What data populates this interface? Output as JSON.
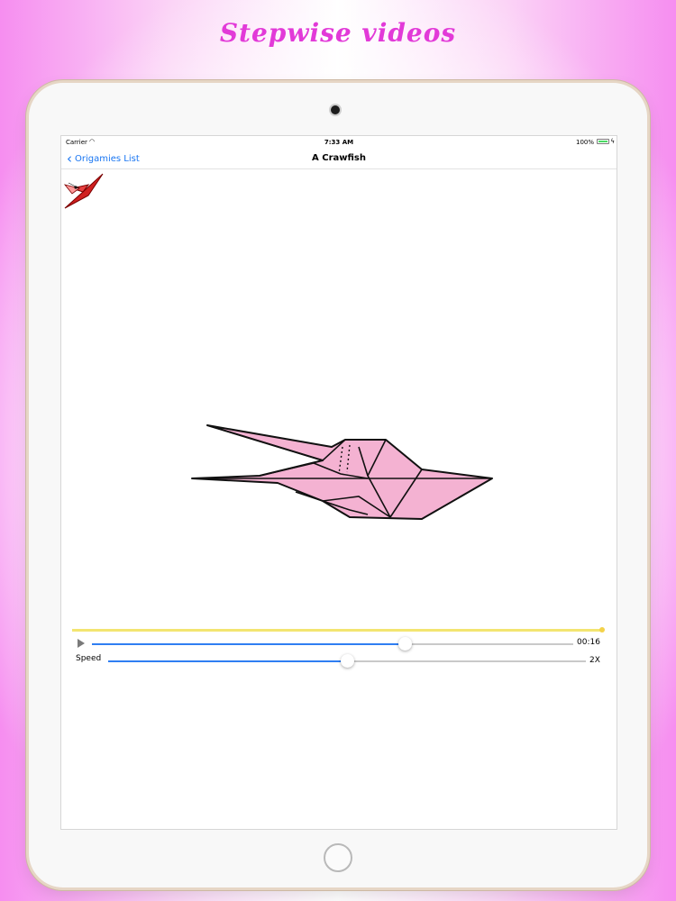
{
  "headline": "Stepwise videos",
  "status_bar": {
    "carrier": "Carrier",
    "time": "7:33 AM",
    "battery": "100%"
  },
  "nav": {
    "back_label": "Origamies List",
    "title": "A Crawfish"
  },
  "player": {
    "progress_fraction": 1.0,
    "position_fraction": 0.65,
    "time_label": "00:16",
    "speed_label": "Speed",
    "speed_fraction": 0.5,
    "speed_value": "2X"
  },
  "colors": {
    "accent": "#2f7ef2",
    "back_link": "#1976f2",
    "progress": "#f3e571",
    "origami_fill": "#f4b2d2",
    "headline": "#e23ad8",
    "battery": "#4cd964"
  },
  "icons": {
    "back": "chevron-left",
    "thumb": "crawfish-thumbnail",
    "play": "play-triangle",
    "wifi": "wifi",
    "battery": "battery"
  }
}
